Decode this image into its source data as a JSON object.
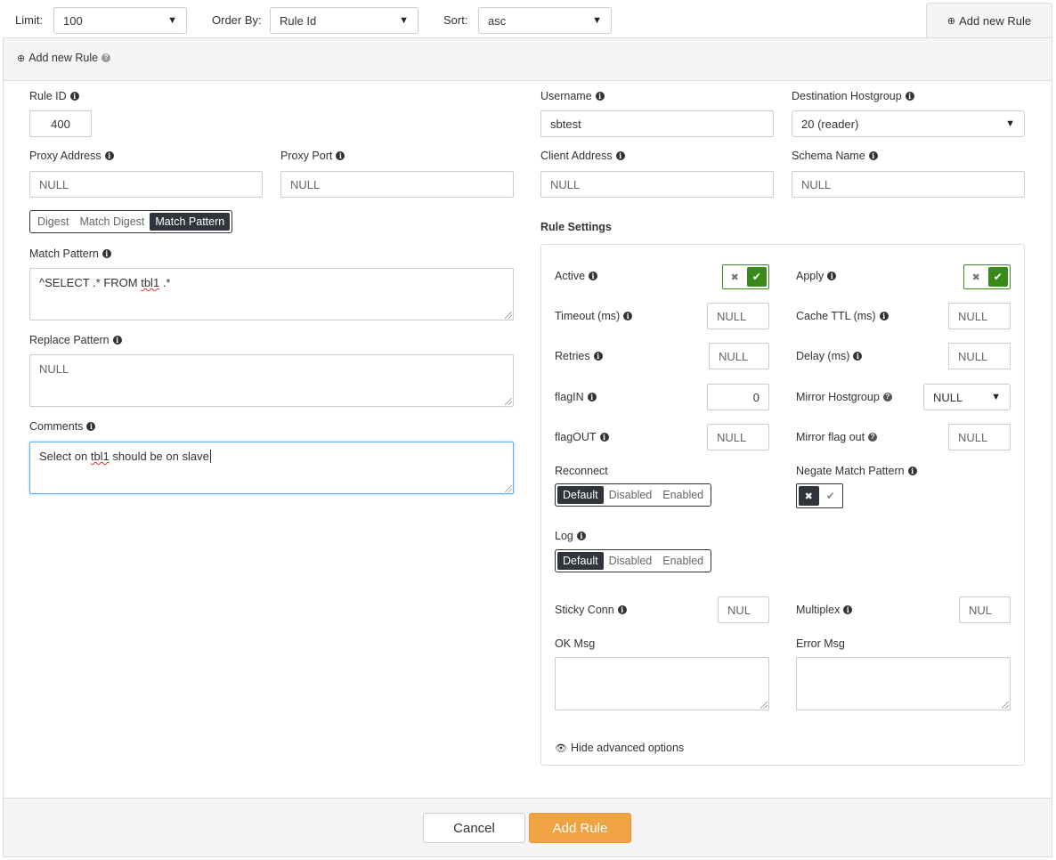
{
  "filters": {
    "limit_label": "Limit:",
    "limit_value": "100",
    "order_label": "Order By:",
    "order_value": "Rule Id",
    "sort_label": "Sort:",
    "sort_value": "asc"
  },
  "tab": {
    "label": "Add new Rule"
  },
  "panel": {
    "title": "Add new Rule"
  },
  "form": {
    "rule_id": {
      "label": "Rule ID",
      "value": "400"
    },
    "username": {
      "label": "Username",
      "value": "sbtest"
    },
    "dest_hostgroup": {
      "label": "Destination Hostgroup",
      "value": "20 (reader)"
    },
    "proxy_address": {
      "label": "Proxy Address",
      "placeholder": "NULL"
    },
    "proxy_port": {
      "label": "Proxy Port",
      "placeholder": "NULL"
    },
    "client_address": {
      "label": "Client Address",
      "placeholder": "NULL"
    },
    "schema_name": {
      "label": "Schema Name",
      "placeholder": "NULL"
    },
    "match_tabs": [
      "Digest",
      "Match Digest",
      "Match Pattern"
    ],
    "match_pattern": {
      "label": "Match Pattern",
      "value_pre": "^SELECT .* FROM ",
      "value_word": "tbl1",
      "value_post": " .*"
    },
    "replace_pattern": {
      "label": "Replace Pattern",
      "placeholder": "NULL"
    },
    "comments": {
      "label": "Comments",
      "value_pre": "Select on ",
      "value_word": "tbl1",
      "value_post": " should be on slave"
    }
  },
  "settings": {
    "heading": "Rule Settings",
    "active": {
      "label": "Active"
    },
    "apply": {
      "label": "Apply"
    },
    "timeout": {
      "label": "Timeout (ms)",
      "placeholder": "NULL"
    },
    "cache_ttl": {
      "label": "Cache TTL (ms)",
      "placeholder": "NULL"
    },
    "retries": {
      "label": "Retries",
      "placeholder": "NULL"
    },
    "delay": {
      "label": "Delay (ms)",
      "placeholder": "NULL"
    },
    "flagin": {
      "label": "flagIN",
      "value": "0"
    },
    "mirror_hostgroup": {
      "label": "Mirror Hostgroup",
      "value": "NULL"
    },
    "flagout": {
      "label": "flagOUT",
      "placeholder": "NULL"
    },
    "mirror_flag_out": {
      "label": "Mirror flag out",
      "placeholder": "NULL"
    },
    "reconnect": {
      "label": "Reconnect",
      "options": [
        "Default",
        "Disabled",
        "Enabled"
      ]
    },
    "negate": {
      "label": "Negate Match Pattern"
    },
    "log": {
      "label": "Log",
      "options": [
        "Default",
        "Disabled",
        "Enabled"
      ]
    },
    "sticky_conn": {
      "label": "Sticky Conn",
      "placeholder": "NUL"
    },
    "multiplex": {
      "label": "Multiplex",
      "placeholder": "NUL"
    },
    "ok_msg": {
      "label": "OK Msg"
    },
    "error_msg": {
      "label": "Error Msg"
    },
    "hide_advanced": "Hide advanced options"
  },
  "footer": {
    "cancel": "Cancel",
    "add": "Add Rule"
  }
}
